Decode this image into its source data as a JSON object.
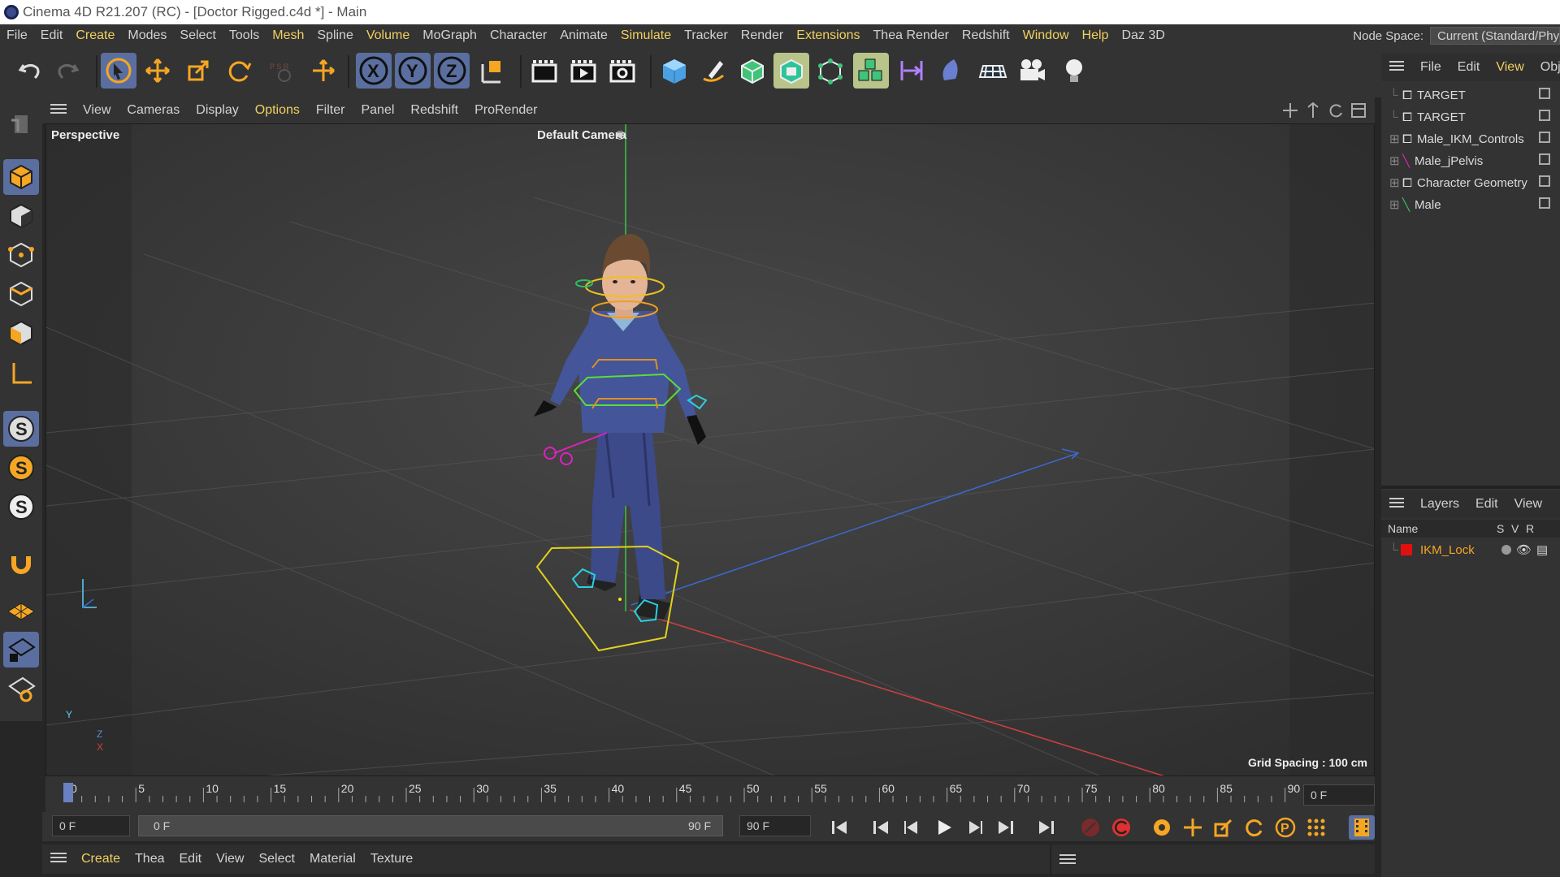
{
  "window": {
    "title": "Cinema 4D R21.207 (RC) - [Doctor Rigged.c4d *] - Main"
  },
  "menu": {
    "items": [
      "File",
      "Edit",
      "Create",
      "Modes",
      "Select",
      "Tools",
      "Mesh",
      "Spline",
      "Volume",
      "MoGraph",
      "Character",
      "Animate",
      "Simulate",
      "Tracker",
      "Render",
      "Extensions",
      "Thea Render",
      "Redshift",
      "Window",
      "Help",
      "Daz 3D"
    ],
    "highlighted": [
      "Create",
      "Mesh",
      "Volume",
      "Simulate",
      "Extensions",
      "Window",
      "Help"
    ],
    "node_space_label": "Node Space:",
    "node_space_value": "Current (Standard/Physical)"
  },
  "viewport_menu": {
    "items": [
      "View",
      "Cameras",
      "Display",
      "Options",
      "Filter",
      "Panel",
      "Redshift",
      "ProRender"
    ],
    "highlighted": "Options"
  },
  "viewport": {
    "view_name": "Perspective",
    "camera": "Default Camera",
    "grid_spacing": "Grid Spacing : 100 cm",
    "axis_y": "Y",
    "axis_z": "Z",
    "axis_x": "X"
  },
  "object_manager": {
    "menu": [
      "File",
      "Edit",
      "View",
      "Objects"
    ],
    "active_menu": "View",
    "objects": [
      "TARGET",
      "TARGET",
      "Male_IKM_Controls",
      "Male_jPelvis",
      "Character Geometry",
      "Male"
    ]
  },
  "layers": {
    "menu": [
      "Layers",
      "Edit",
      "View"
    ],
    "columns": {
      "name": "Name",
      "s": "S",
      "v": "V",
      "r": "R"
    },
    "rows": [
      {
        "name": "IKM_Lock",
        "color": "#e01010"
      }
    ]
  },
  "timeline": {
    "ticks": [
      "0",
      "5",
      "10",
      "15",
      "20",
      "25",
      "30",
      "35",
      "40",
      "45",
      "50",
      "55",
      "60",
      "65",
      "70",
      "75",
      "80",
      "85",
      "90"
    ],
    "current_frame": "0 F",
    "start_field": "0 F",
    "range_start": "0 F",
    "range_end": "90 F",
    "end_field": "90 F"
  },
  "material_menu": {
    "items": [
      "Create",
      "Thea",
      "Edit",
      "View",
      "Select",
      "Material",
      "Texture"
    ],
    "highlighted": "Create"
  },
  "colors": {
    "accent": "#f0d060",
    "orange": "#f5a623",
    "active_blue": "#5a6fa0"
  }
}
